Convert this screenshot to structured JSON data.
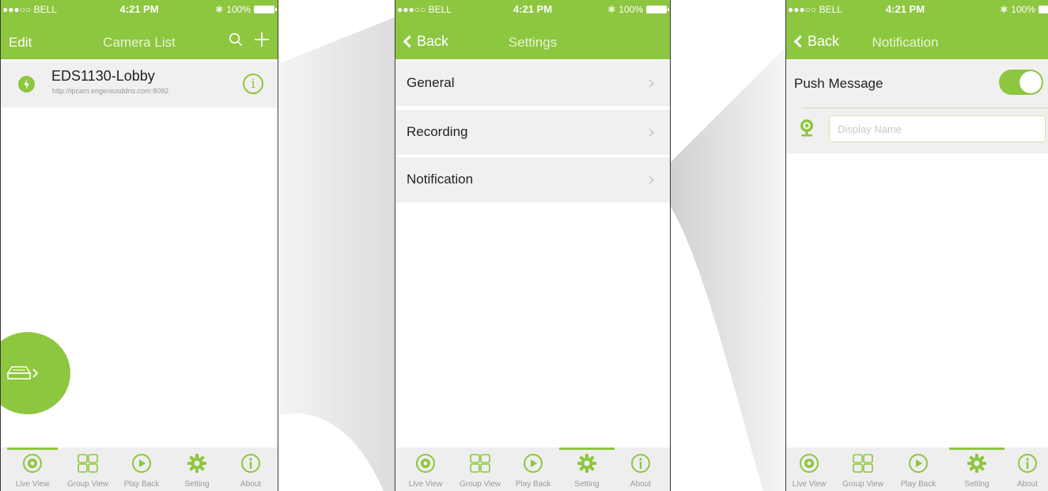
{
  "colors": {
    "accent": "#8dc63f",
    "row_bg": "#f0f0f0",
    "tab_bg": "#eeeeee"
  },
  "status_bar": {
    "carrier": "●●●○○ BELL",
    "time": "4:21 PM",
    "battery": "100%"
  },
  "screen1": {
    "nav": {
      "edit": "Edit",
      "title": "Camera List"
    },
    "camera": {
      "name": "EDS1130-Lobby",
      "url": "http://ipcam.engeniusddns.com:8092"
    }
  },
  "screen2": {
    "nav": {
      "back": "Back",
      "title": "Settings"
    },
    "items": [
      "General",
      "Recording",
      "Notification"
    ]
  },
  "screen3": {
    "nav": {
      "back": "Back",
      "title": "Notification"
    },
    "push_message": "Push Message",
    "push_enabled": true,
    "display_name_placeholder": "Display Name"
  },
  "tabs": [
    "Live View",
    "Group View",
    "Play Back",
    "Setting",
    "About"
  ],
  "tab_icons": [
    "live-view-icon",
    "group-view-icon",
    "play-back-icon",
    "gear-icon",
    "about-icon"
  ],
  "active_tab": {
    "screen1": "Live View",
    "screen2": "Setting",
    "screen3": "Setting"
  }
}
